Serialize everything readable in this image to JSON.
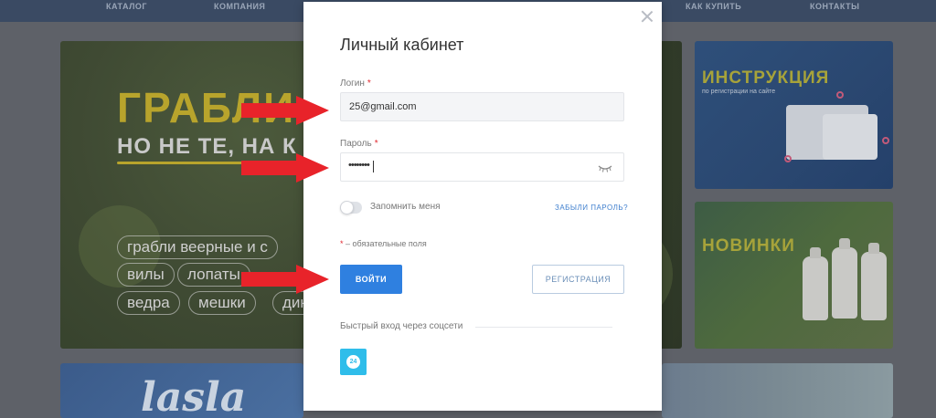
{
  "background": {
    "nav": [
      "КАТАЛОГ",
      "КОМПАНИЯ",
      "КАК КУПИТЬ",
      "КОНТАКТЫ"
    ],
    "main_banner": {
      "title": "ГРАБЛИ",
      "subtitle": "НО НЕ ТЕ, НА К",
      "tags": [
        "грабли веерные и с",
        "вилы",
        "лопаты",
        "ведра",
        "мешки",
        "дик"
      ]
    },
    "side_banner_1": {
      "title": "ИНСТРУКЦИЯ",
      "subtitle": "по регистрации на сайте"
    },
    "side_banner_2": {
      "title": "НОВИНКИ"
    },
    "bottom_banner_1": {
      "text": "lasla"
    }
  },
  "modal": {
    "title": "Личный кабинет",
    "login": {
      "label": "Логин",
      "required_mark": "*",
      "value": "25@gmail.com"
    },
    "password": {
      "label": "Пароль",
      "required_mark": "*",
      "masked_value": "••••••••"
    },
    "remember_label": "Запомнить меня",
    "remember_checked": false,
    "forgot_label": "ЗАБЫЛИ ПАРОЛЬ?",
    "required_note": {
      "star": "*",
      "text": " – обязательные поля"
    },
    "login_button": "ВОЙТИ",
    "register_button": "РЕГИСТРАЦИЯ",
    "social_label": "Быстрый вход через соцсети",
    "social_icons": [
      {
        "name": "bitrix24-icon",
        "glyph": "24"
      }
    ]
  },
  "annotations": {
    "arrow_color": "#e8232a"
  },
  "colors": {
    "primary": "#2f80e0",
    "required": "#e0282f",
    "link": "#3f7fce",
    "social_b24": "#2fbdea"
  }
}
